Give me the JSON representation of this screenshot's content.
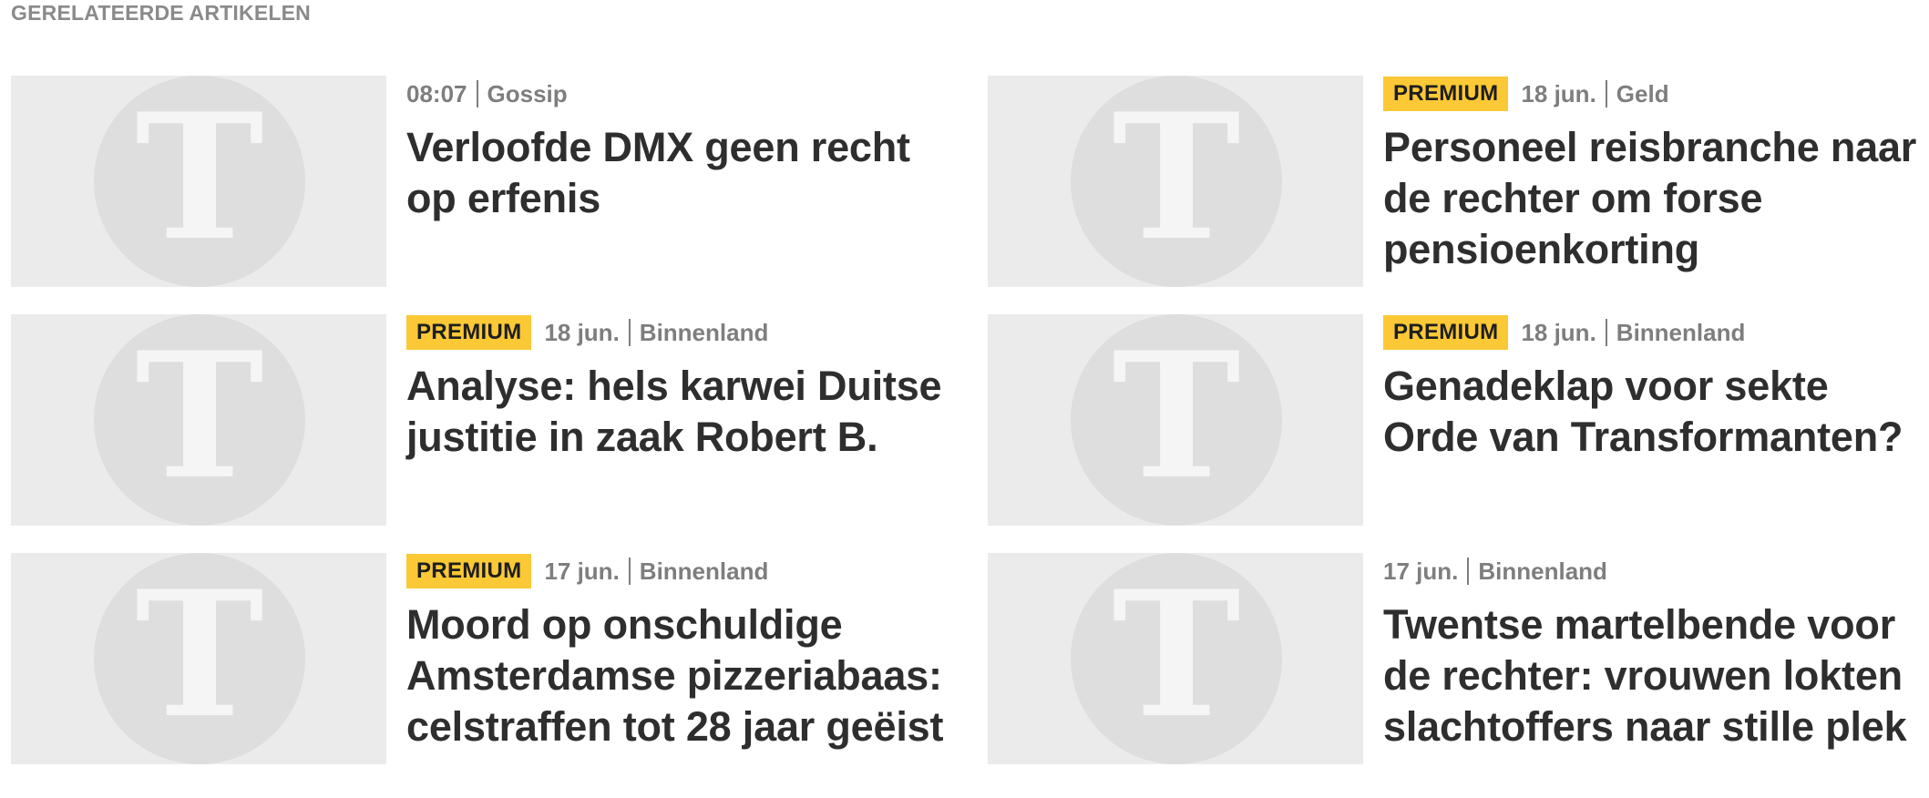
{
  "section_title": "GERELATEERDE ARTIKELEN",
  "colors": {
    "premium_badge": "#fbc935",
    "meta_text": "#7e7e7e",
    "headline": "#2e2e2e",
    "thumb_bg": "#ebebeb",
    "logo_circle": "#dedede",
    "logo_letter": "#f5f5f5"
  },
  "thumbnail_icon": "telegraaf-t-logo-icon",
  "articles": [
    {
      "premium": "",
      "date": "08:07",
      "category": "Gossip",
      "headline": "Verloofde DMX geen recht op erfenis"
    },
    {
      "premium": "PREMIUM",
      "date": "18 jun.",
      "category": "Geld",
      "headline": "Personeel reisbranche naar de rechter om forse pensioenkorting"
    },
    {
      "premium": "PREMIUM",
      "date": "18 jun.",
      "category": "Binnenland",
      "headline": "Analyse: hels karwei Duitse justitie in zaak Robert B."
    },
    {
      "premium": "PREMIUM",
      "date": "18 jun.",
      "category": "Binnenland",
      "headline": "Genadeklap voor sekte Orde van Transformanten?"
    },
    {
      "premium": "PREMIUM",
      "date": "17 jun.",
      "category": "Binnenland",
      "headline": "Moord op onschuldige Amsterdamse pizzeriabaas: celstraffen tot 28 jaar geëist"
    },
    {
      "premium": "",
      "date": "17 jun.",
      "category": "Binnenland",
      "headline": "Twentse martelbende voor de rechter: vrouwen lokten slachtoffers naar stille plek"
    }
  ]
}
